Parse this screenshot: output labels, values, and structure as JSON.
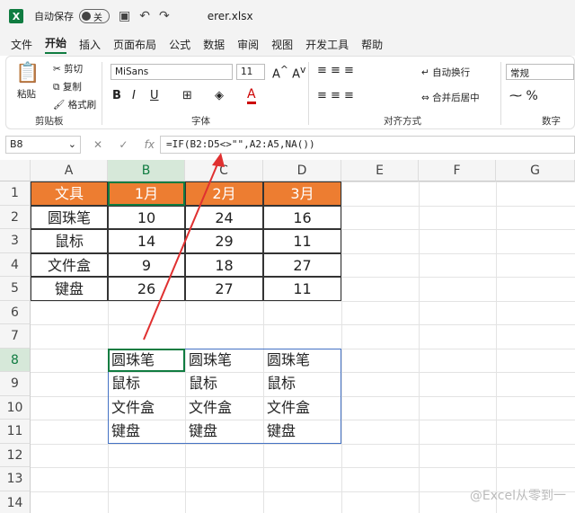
{
  "titlebar": {
    "autosave_label": "自动保存",
    "toggle_state": "关",
    "filename": "erer.xlsx"
  },
  "menu": [
    "文件",
    "开始",
    "插入",
    "页面布局",
    "公式",
    "数据",
    "审阅",
    "视图",
    "开发工具",
    "帮助"
  ],
  "ribbon": {
    "paste": "粘贴",
    "cut": "剪切",
    "copy": "复制",
    "format_painter": "格式刷",
    "clipboard": "剪贴板",
    "font_name": "MiSans",
    "font_size": "11",
    "font_group": "字体",
    "wrap": "自动换行",
    "merge": "合并后居中",
    "align_group": "对齐方式",
    "number_format": "常规",
    "number_group": "数字"
  },
  "formula_bar": {
    "name_box": "B8",
    "fx": "fx",
    "formula": "=IF(B2:D5<>\"\",A2:A5,NA())"
  },
  "columns": [
    "A",
    "B",
    "C",
    "D",
    "E",
    "F",
    "G"
  ],
  "rows": [
    "1",
    "2",
    "3",
    "4",
    "5",
    "6",
    "7",
    "8",
    "9",
    "10",
    "11",
    "12",
    "13",
    "14"
  ],
  "table": {
    "header": [
      "文具",
      "1月",
      "2月",
      "3月"
    ],
    "body": [
      [
        "圆珠笔",
        "10",
        "24",
        "16"
      ],
      [
        "鼠标",
        "14",
        "29",
        "11"
      ],
      [
        "文件盒",
        "9",
        "18",
        "27"
      ],
      [
        "键盘",
        "26",
        "27",
        "11"
      ]
    ]
  },
  "result": [
    [
      "圆珠笔",
      "圆珠笔",
      "圆珠笔"
    ],
    [
      "鼠标",
      "鼠标",
      "鼠标"
    ],
    [
      "文件盒",
      "文件盒",
      "文件盒"
    ],
    [
      "键盘",
      "键盘",
      "键盘"
    ]
  ],
  "watermark": "@Excel从零到一",
  "colors": {
    "header_fill": "#ed7d31",
    "excel_green": "#107c41",
    "arrow": "#e03030"
  }
}
